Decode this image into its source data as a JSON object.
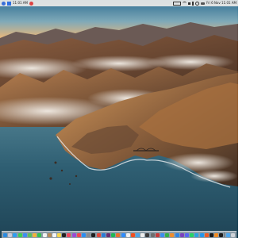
{
  "menubar": {
    "status_icons": [
      {
        "name": "notification-icon",
        "color": "#3a6fd8"
      },
      {
        "name": "dropbox-icon",
        "color": "#2f6fe0"
      },
      {
        "name": "app-status-icon",
        "color": "#d44"
      }
    ],
    "clock_left_text": "11:01 AM",
    "battery_label": "",
    "right_icons": [
      {
        "name": "wifi-icon",
        "color": "#333"
      },
      {
        "name": "volume-icon",
        "color": "#333"
      },
      {
        "name": "bluetooth-icon",
        "color": "#333"
      },
      {
        "name": "search-icon",
        "color": "#333"
      },
      {
        "name": "control-center-icon",
        "color": "#333"
      }
    ],
    "datetime": "Fri 6 Nov 11:01 AM"
  },
  "dock": {
    "apps": [
      {
        "name": "finder-icon",
        "color": "#2b8be0"
      },
      {
        "name": "launchpad-icon",
        "color": "#c9c9d6"
      },
      {
        "name": "safari-icon",
        "color": "#2e9ef0"
      },
      {
        "name": "messages-icon",
        "color": "#3bcf52"
      },
      {
        "name": "mail-icon",
        "color": "#3d8ef2"
      },
      {
        "name": "maps-icon",
        "color": "#5ac05a"
      },
      {
        "name": "photos-icon",
        "color": "#f0b43a"
      },
      {
        "name": "facetime-icon",
        "color": "#32c24d"
      },
      {
        "name": "calendar-icon",
        "color": "#f3f3f3"
      },
      {
        "name": "contacts-icon",
        "color": "#b88a58"
      },
      {
        "name": "reminders-icon",
        "color": "#f5f5f5"
      },
      {
        "name": "notes-icon",
        "color": "#f6d64a"
      },
      {
        "name": "tv-icon",
        "color": "#222222"
      },
      {
        "name": "music-icon",
        "color": "#f0465c"
      },
      {
        "name": "podcasts-icon",
        "color": "#9a49d6"
      },
      {
        "name": "news-icon",
        "color": "#f2464f"
      },
      {
        "name": "app-store-icon",
        "color": "#2c8df2"
      },
      {
        "name": "system-preferences-icon",
        "color": "#8a8a8e"
      },
      {
        "name": "terminal-icon",
        "color": "#1f1f1f"
      },
      {
        "name": "chrome-icon",
        "color": "#e2463a"
      },
      {
        "name": "vscode-icon",
        "color": "#2b7bd6"
      },
      {
        "name": "slack-icon",
        "color": "#6b2d70"
      },
      {
        "name": "spotify-icon",
        "color": "#1db954"
      },
      {
        "name": "firefox-icon",
        "color": "#e8722c"
      },
      {
        "name": "zoom-icon",
        "color": "#2d8cff"
      },
      {
        "name": "notion-icon",
        "color": "#efefef"
      },
      {
        "name": "figma-icon",
        "color": "#f24e1e"
      },
      {
        "name": "preview-icon",
        "color": "#4aa3e6"
      },
      {
        "name": "textedit-icon",
        "color": "#ededed"
      },
      {
        "name": "activity-monitor-icon",
        "color": "#3b3b3b"
      },
      {
        "name": "calculator-icon",
        "color": "#6e6e6e"
      },
      {
        "name": "photo-booth-icon",
        "color": "#c63a3a"
      },
      {
        "name": "keynote-icon",
        "color": "#3a8ef0"
      },
      {
        "name": "numbers-icon",
        "color": "#34b046"
      },
      {
        "name": "pages-icon",
        "color": "#f08c2c"
      },
      {
        "name": "xcode-icon",
        "color": "#2e84e6"
      },
      {
        "name": "github-desktop-icon",
        "color": "#7b3fbf"
      },
      {
        "name": "discord-icon",
        "color": "#5865f2"
      },
      {
        "name": "whatsapp-icon",
        "color": "#25d366"
      },
      {
        "name": "telegram-icon",
        "color": "#2aa3df"
      },
      {
        "name": "docker-icon",
        "color": "#2496ed"
      },
      {
        "name": "postman-icon",
        "color": "#ef5b25"
      },
      {
        "name": "iterm-icon",
        "color": "#1a1a1a"
      },
      {
        "name": "books-icon",
        "color": "#f38a1f"
      },
      {
        "name": "stocks-icon",
        "color": "#1c1c1c"
      }
    ],
    "tail_apps": [
      {
        "name": "downloads-folder-icon",
        "color": "#4aa6f0"
      },
      {
        "name": "trash-icon",
        "color": "#cfd3d8"
      }
    ]
  }
}
